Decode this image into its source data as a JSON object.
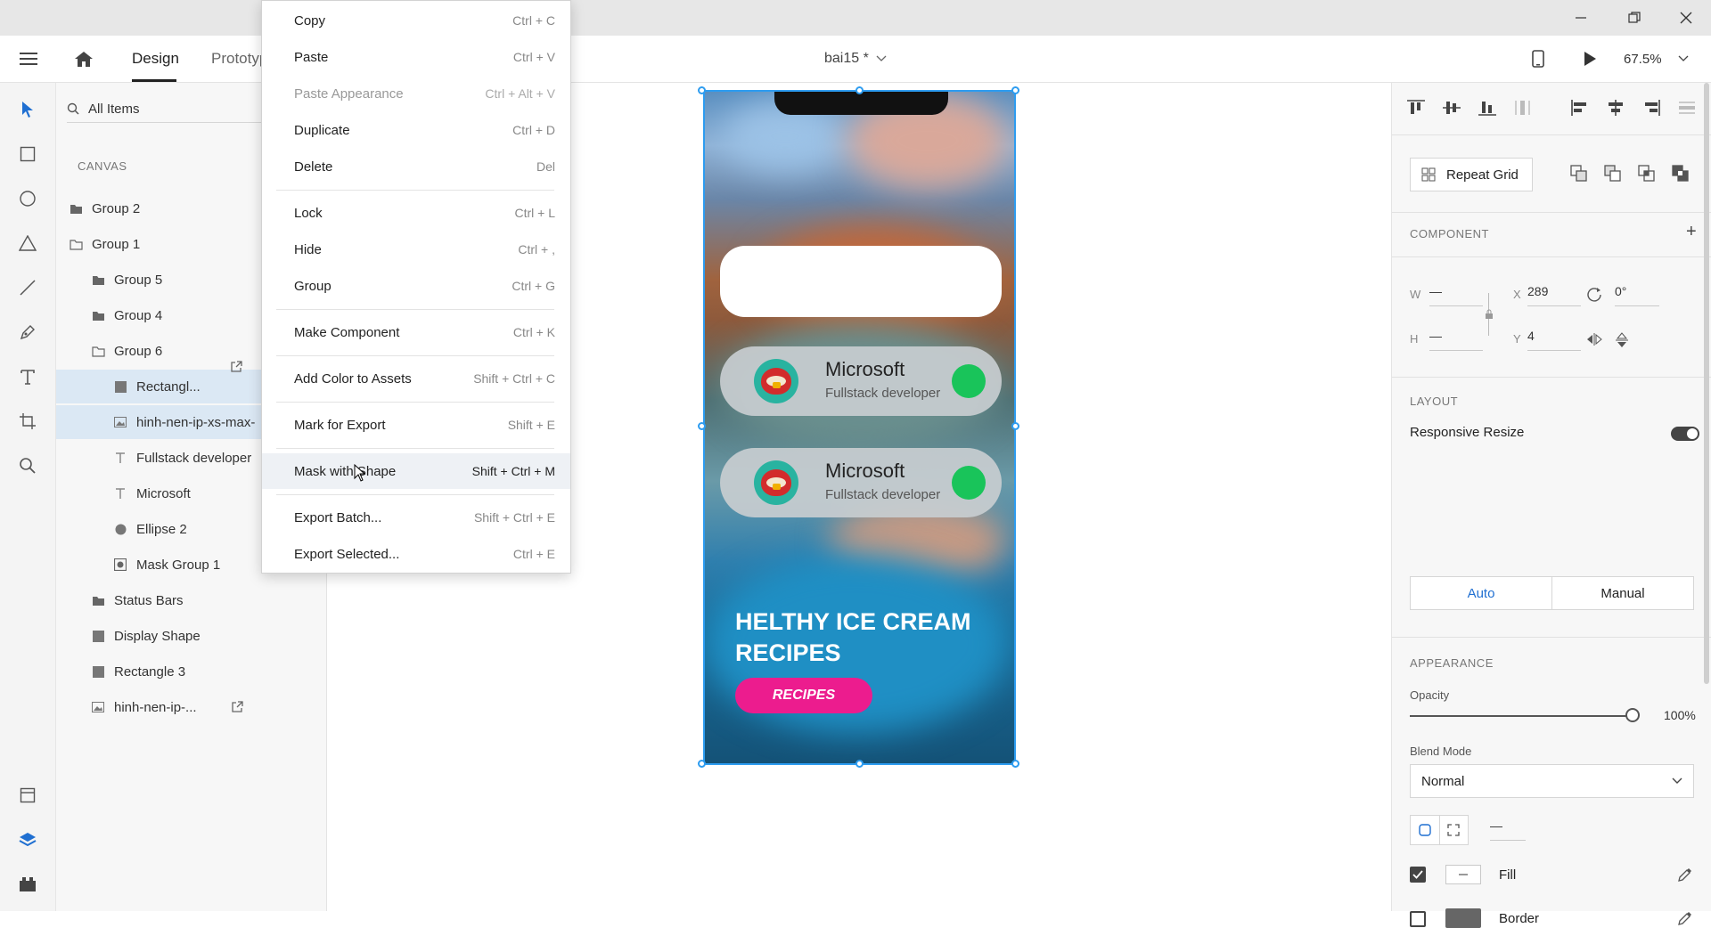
{
  "header": {
    "tabs": [
      {
        "label": "Design"
      },
      {
        "label": "Prototyp"
      }
    ],
    "doc_title": "bai15 *",
    "zoom": "67.5%"
  },
  "layers": {
    "search_placeholder": "All Items",
    "section": "CANVAS",
    "items": [
      {
        "label": "Group 2",
        "icon": "folder-icon"
      },
      {
        "label": "Group 1",
        "icon": "folder-open-icon"
      },
      {
        "label": "Group 5",
        "icon": "folder-icon"
      },
      {
        "label": "Group 4",
        "icon": "folder-icon"
      },
      {
        "label": "Group 6",
        "icon": "folder-open-icon"
      },
      {
        "label": "Rectangl...",
        "icon": "rectangle-icon"
      },
      {
        "label": "hinh-nen-ip-xs-max-",
        "icon": "image-icon"
      },
      {
        "label": "Fullstack developer",
        "icon": "text-icon"
      },
      {
        "label": "Microsoft",
        "icon": "text-icon"
      },
      {
        "label": "Ellipse 2",
        "icon": "ellipse-icon"
      },
      {
        "label": "Mask Group 1",
        "icon": "mask-icon"
      },
      {
        "label": "Status Bars",
        "icon": "folder-icon"
      },
      {
        "label": "Display Shape",
        "icon": "rectangle-icon"
      },
      {
        "label": "Rectangle 3",
        "icon": "rectangle-icon"
      },
      {
        "label": "hinh-nen-ip-...",
        "icon": "image-icon"
      }
    ]
  },
  "context_menu": {
    "items": [
      {
        "label": "Copy",
        "shortcut": "Ctrl + C"
      },
      {
        "label": "Paste",
        "shortcut": "Ctrl + V"
      },
      {
        "label": "Paste Appearance",
        "shortcut": "Ctrl + Alt + V"
      },
      {
        "label": "Duplicate",
        "shortcut": "Ctrl + D"
      },
      {
        "label": "Delete",
        "shortcut": "Del"
      },
      {
        "label": "Lock",
        "shortcut": "Ctrl + L"
      },
      {
        "label": "Hide",
        "shortcut": "Ctrl + ,"
      },
      {
        "label": "Group",
        "shortcut": "Ctrl + G"
      },
      {
        "label": "Make Component",
        "shortcut": "Ctrl + K"
      },
      {
        "label": "Add Color to Assets",
        "shortcut": "Shift + Ctrl + C"
      },
      {
        "label": "Mark for Export",
        "shortcut": "Shift + E"
      },
      {
        "label": "Mask with Shape",
        "shortcut": "Shift + Ctrl + M"
      },
      {
        "label": "Export Batch...",
        "shortcut": "Shift + Ctrl + E"
      },
      {
        "label": "Export Selected...",
        "shortcut": "Ctrl + E"
      }
    ]
  },
  "artboard": {
    "cards": [
      {
        "title": "Microsoft",
        "subtitle": "Fullstack developer"
      },
      {
        "title": "Microsoft",
        "subtitle": "Fullstack developer"
      }
    ],
    "headline": "HELTHY ICE CREAM RECIPES",
    "button": "RECIPES",
    "accent": "#ec1c8e",
    "status_green": "#19c45a",
    "selection_blue": "#2d9cf0"
  },
  "props": {
    "repeat_grid": "Repeat Grid",
    "component_label": "COMPONENT",
    "w_label": "W",
    "w_value": "—",
    "h_label": "H",
    "h_value": "—",
    "x_label": "X",
    "x_value": "289",
    "y_label": "Y",
    "y_value": "4",
    "rotation": "0°",
    "layout_label": "LAYOUT",
    "responsive_resize": "Responsive Resize",
    "auto": "Auto",
    "manual": "Manual",
    "appearance_label": "APPEARANCE",
    "opacity_label": "Opacity",
    "opacity_value": "100%",
    "blend_label": "Blend Mode",
    "blend_value": "Normal",
    "corner_value": "—",
    "fill_label": "Fill",
    "border_label": "Border"
  }
}
